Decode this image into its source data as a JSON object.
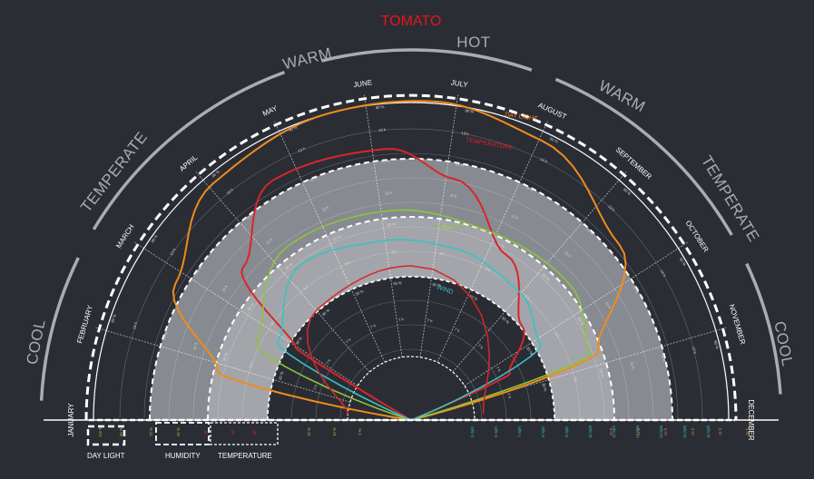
{
  "title": "TOMATO",
  "seasons": [
    {
      "label": "COOL"
    },
    {
      "label": "TEMPERATE"
    },
    {
      "label": "WARM"
    },
    {
      "label": "HOT"
    },
    {
      "label": "WARM"
    },
    {
      "label": "TEMPERATE"
    },
    {
      "label": "COOL"
    }
  ],
  "months": [
    "JANUARY",
    "FEBRUARY",
    "MARCH",
    "APRIL",
    "MAY",
    "JUNE",
    "JULY",
    "AUGUST",
    "SEPTEMBER",
    "OCTOBER",
    "NOVEMBER",
    "DECEMBER"
  ],
  "legend": {
    "daylight": "DAY LIGHT",
    "humidity": "HUMIDITY",
    "temperature": "TEMPERATURE"
  },
  "scales": {
    "daylight": [
      "5 h",
      "6 h",
      "7 h",
      "8 h",
      "9 h",
      "10 h",
      "11 h",
      "12 h",
      "13 h",
      "14 h",
      "15 h"
    ],
    "humidity": [
      "0 %",
      "10 %",
      "20 %",
      "30 %",
      "40 %",
      "50 %",
      "60 %",
      "70 %",
      "80 %",
      "90 %",
      "100 %"
    ],
    "temperature": [
      "0°",
      "5°",
      "10°",
      "15°",
      "20°",
      "25°",
      "30°",
      "35°",
      "40°",
      "45°"
    ],
    "wind": [
      "5 mph",
      "6 mph",
      "7 mph",
      "8 mph",
      "9 mph",
      "10 mph",
      "11 mph",
      "12 mph",
      "13 mph",
      "14 mph",
      "15 mph"
    ]
  },
  "curves": [
    {
      "label": "DAY LIGHT",
      "color": "#f08c1c"
    },
    {
      "label": "TEMPERATURE",
      "color": "#d8262b"
    },
    {
      "label": "HUMIDITY",
      "color": "#8cc43c"
    },
    {
      "label": "WIND",
      "color": "#37c3c4"
    }
  ],
  "colors": {
    "background": "#2b2d35",
    "accent": "#e3161b",
    "season_arc": "#a9acb3"
  }
}
